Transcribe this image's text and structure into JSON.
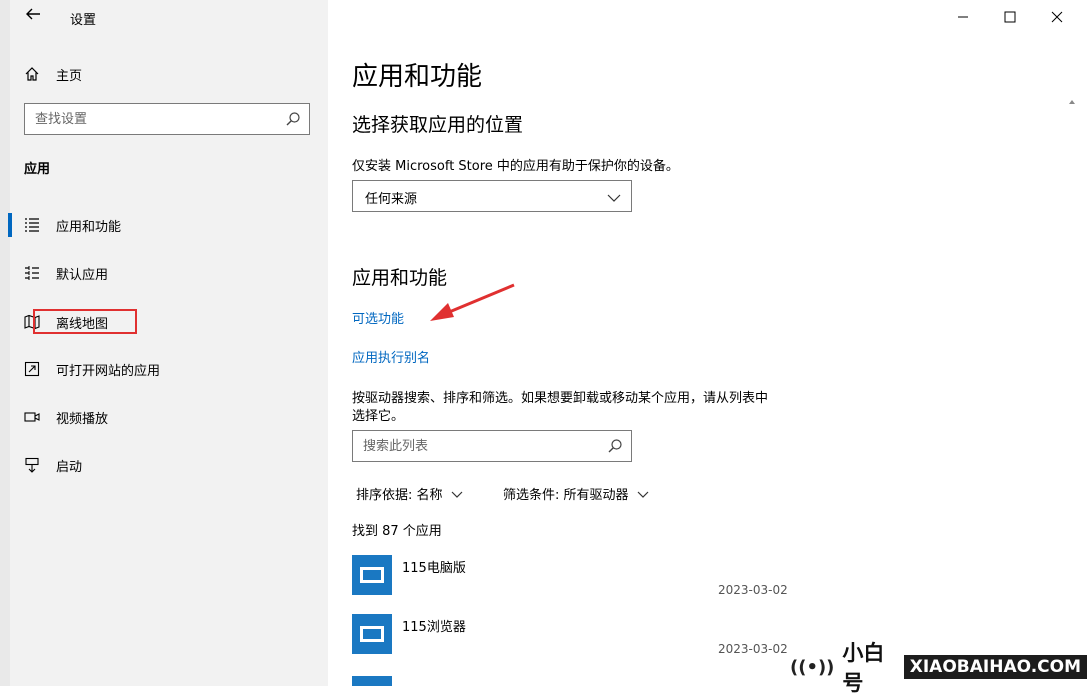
{
  "window": {
    "title": "设置"
  },
  "sidebar": {
    "home_label": "主页",
    "search_placeholder": "查找设置",
    "section_label": "应用",
    "items": [
      {
        "label": "应用和功能",
        "icon": "apps-list-icon"
      },
      {
        "label": "默认应用",
        "icon": "default-apps-icon"
      },
      {
        "label": "离线地图",
        "icon": "map-icon"
      },
      {
        "label": "可打开网站的应用",
        "icon": "open-website-icon"
      },
      {
        "label": "视频播放",
        "icon": "video-icon"
      },
      {
        "label": "启动",
        "icon": "startup-icon"
      }
    ]
  },
  "main": {
    "page_title": "应用和功能",
    "source_heading": "选择获取应用的位置",
    "source_desc": "仅安装 Microsoft Store 中的应用有助于保护你的设备。",
    "source_value": "任何来源",
    "apps_heading": "应用和功能",
    "link_optional": "可选功能",
    "link_alias": "应用执行别名",
    "filter_desc_1": "按驱动器搜索、排序和筛选。如果想要卸载或移动某个应用，请从列表中",
    "filter_desc_2": "选择它。",
    "search_placeholder": "搜索此列表",
    "sort_label": "排序依据: 名称",
    "filter_label": "筛选条件: 所有驱动器",
    "count_text": "找到 87 个应用",
    "apps": [
      {
        "name": "115电脑版",
        "date": "2023-03-02"
      },
      {
        "name": "115浏览器",
        "date": "2023-03-02"
      }
    ]
  },
  "brand": {
    "name": "小白号",
    "domain": "XIAOBAIHAO.COM"
  },
  "colors": {
    "accent": "#0067c0",
    "highlight": "#e03030",
    "app_tile": "#1a78c2"
  }
}
